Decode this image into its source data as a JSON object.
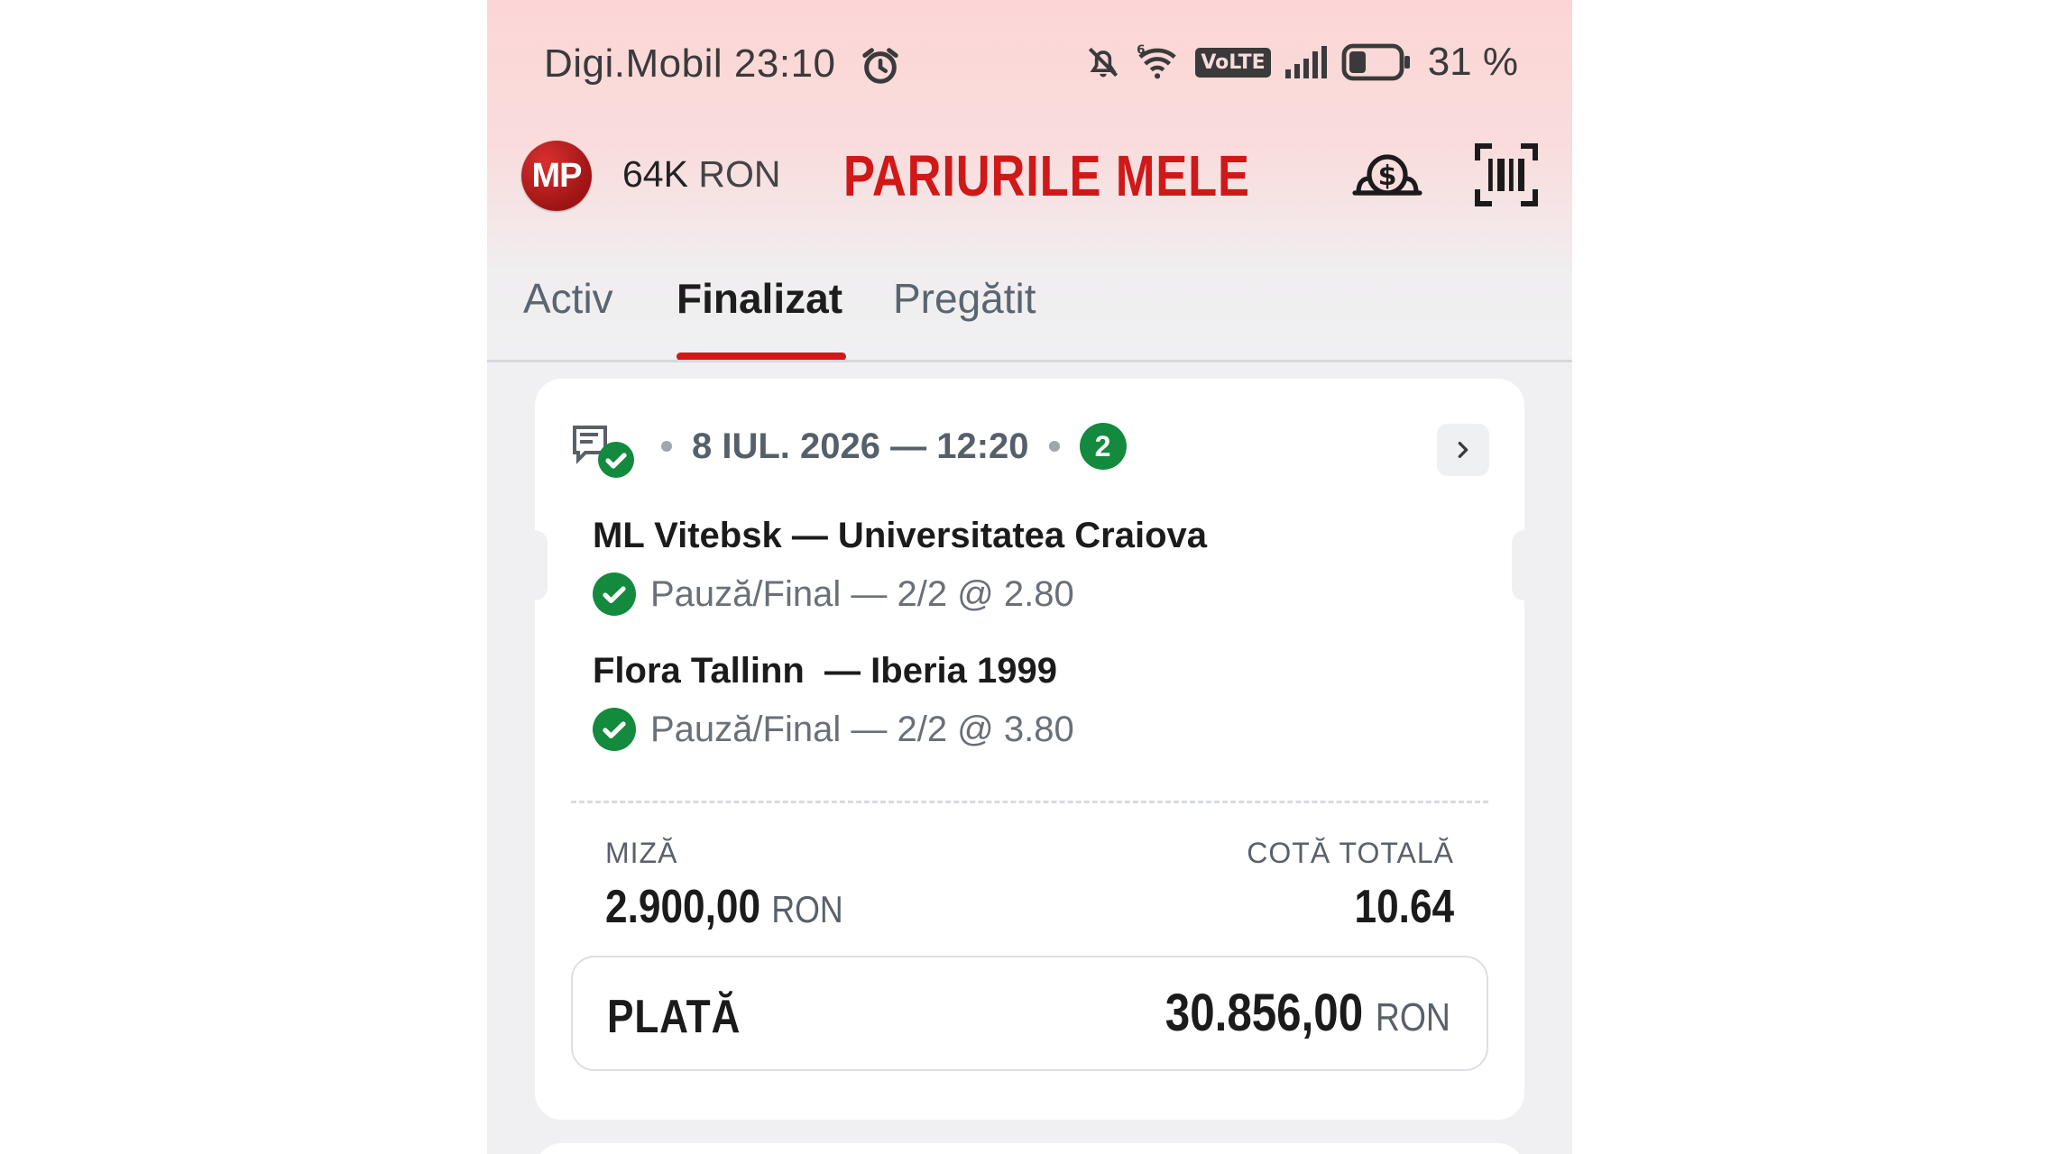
{
  "status_bar": {
    "carrier": "Digi.Mobil",
    "time": "23:10",
    "volte": "VoLTE",
    "battery": "31 %"
  },
  "header": {
    "avatar_initials": "MP",
    "balance_amount": "64K",
    "balance_currency": "RON",
    "title": "PARIURILE MELE"
  },
  "tabs": [
    {
      "label": "Activ",
      "active": false
    },
    {
      "label": "Finalizat",
      "active": true
    },
    {
      "label": "Pregătit",
      "active": false
    }
  ],
  "ticket": {
    "date": "8 IUL. 2026 — 12:20",
    "selection_count": "2",
    "selections": [
      {
        "match": "ML Vitebsk — Universitatea Craiova",
        "pick": "Pauză/Final — 2/2 @ 2.80"
      },
      {
        "match": "Flora Tallinn  — Iberia 1999",
        "pick": "Pauză/Final — 2/2 @ 3.80"
      }
    ],
    "stake_label": "MIZĂ",
    "stake_value": "2.900,00",
    "stake_currency": "RON",
    "odds_label": "COTĂ TOTALĂ",
    "odds_value": "10.64",
    "payout_label": "PLATĂ",
    "payout_value": "30.856,00",
    "payout_currency": "RON"
  },
  "colors": {
    "brand_red": "#d01818",
    "win_green": "#138a3d"
  },
  "icons": [
    "alarm-icon",
    "mute-icon",
    "wifi-icon",
    "signal-icon",
    "battery-icon",
    "cash-icon",
    "barcode-scan-icon",
    "ticket-check-icon",
    "chevron-right-icon",
    "check-circle-icon"
  ]
}
